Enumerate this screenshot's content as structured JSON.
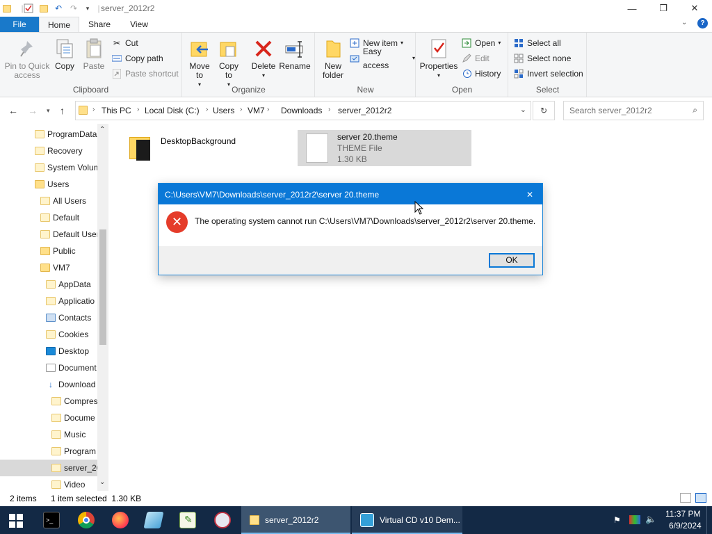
{
  "window": {
    "title": "server_2012r2",
    "controls": {
      "minimize": "—",
      "maximize": "❐",
      "close": "✕"
    }
  },
  "ribbon_tabs": [
    "File",
    "Home",
    "Share",
    "View"
  ],
  "ribbon": {
    "clipboard": {
      "label": "Clipboard",
      "pin": "Pin to Quick access",
      "copy": "Copy",
      "paste": "Paste",
      "cut": "Cut",
      "copy_path": "Copy path",
      "paste_shortcut": "Paste shortcut"
    },
    "organize": {
      "label": "Organize",
      "move_to": "Move to",
      "copy_to": "Copy to",
      "delete": "Delete",
      "rename": "Rename"
    },
    "new": {
      "label": "New",
      "new_folder": "New folder",
      "new_item": "New item",
      "easy_access": "Easy access"
    },
    "open": {
      "label": "Open",
      "properties": "Properties",
      "open": "Open",
      "edit": "Edit",
      "history": "History"
    },
    "select": {
      "label": "Select",
      "select_all": "Select all",
      "select_none": "Select none",
      "invert_selection": "Invert selection"
    }
  },
  "address": {
    "crumbs": [
      "This PC",
      "Local Disk (C:)",
      "Users",
      "VM7",
      "Downloads",
      "server_2012r2"
    ],
    "search_placeholder": "Search server_2012r2"
  },
  "nav_tree": [
    {
      "label": "ProgramData"
    },
    {
      "label": "Recovery"
    },
    {
      "label": "System Volum"
    },
    {
      "label": "Users"
    },
    {
      "label": "All Users"
    },
    {
      "label": "Default"
    },
    {
      "label": "Default User"
    },
    {
      "label": "Public"
    },
    {
      "label": "VM7"
    },
    {
      "label": "AppData"
    },
    {
      "label": "Applicatio"
    },
    {
      "label": "Contacts"
    },
    {
      "label": "Cookies"
    },
    {
      "label": "Desktop"
    },
    {
      "label": "Document"
    },
    {
      "label": "Download"
    },
    {
      "label": "Compres"
    },
    {
      "label": "Docume"
    },
    {
      "label": "Music"
    },
    {
      "label": "Program"
    },
    {
      "label": "server_20"
    },
    {
      "label": "Video"
    }
  ],
  "files": [
    {
      "name": "DesktopBackground"
    },
    {
      "name": "server 20.theme",
      "type": "THEME File",
      "size": "1.30 KB"
    }
  ],
  "dialog": {
    "title": "C:\\Users\\VM7\\Downloads\\server_2012r2\\server 20.theme",
    "message": "The operating system cannot run C:\\Users\\VM7\\Downloads\\server_2012r2\\server 20.theme.",
    "ok": "OK"
  },
  "status": {
    "items": "2 items",
    "selected": "1 item selected  1.30 KB"
  },
  "taskbar": {
    "apps": [
      "server_2012r2",
      "Virtual CD v10 Dem..."
    ],
    "time": "11:37 PM",
    "date": "6/9/2024"
  }
}
